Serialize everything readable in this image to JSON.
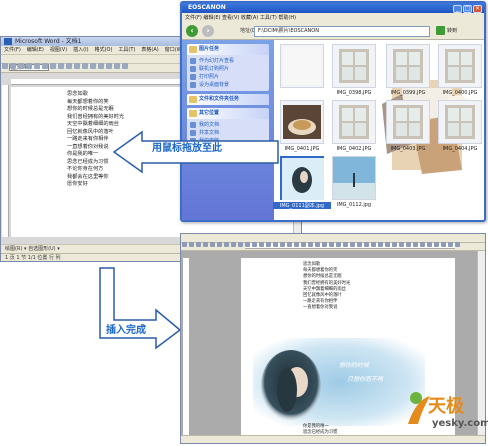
{
  "word_window": {
    "title": "Microsoft Word - 文档1",
    "menus": [
      "文件(F)",
      "编辑(E)",
      "视图(V)",
      "插入(I)",
      "格式(O)",
      "工具(T)",
      "表格(A)",
      "窗口(W)",
      "帮助(H)"
    ],
    "style_box": "正文 宋体",
    "doc_lines": [
      "思念如歌",
      "每天都想着你的笑",
      "想你的时候总是无眠",
      "我们曾经拥有的美好时光",
      "天空中飘着细细的雨丝",
      "回忆就像风中的落叶",
      "一路走来有你相伴",
      "一直想着你对我说",
      "你是我的唯一",
      "思念已经成为习惯",
      "不论你身在何方",
      "我都会在这里等你",
      "愿你安好"
    ],
    "drawbar_label": "绘图(R) ▾  自选图形(U) ▾",
    "status_text": "1 页  1 节  1/1  位置  行  列"
  },
  "explorer_window": {
    "title": "EOSCANON",
    "menus": "文件(F)  编辑(E)  查看(V)  收藏(A)  工具(T)  帮助(H)",
    "address_label": "地址(D)",
    "address_path": "F:\\DCIM\\照片\\EOSCANON",
    "go_label": "转到",
    "sidebar": {
      "picture_tasks": {
        "title": "图片任务",
        "items": [
          "作为幻灯片查看",
          "联机订购照片",
          "打印照片",
          "设为桌面背景"
        ]
      },
      "file_tasks": {
        "title": "文件和文件夹任务"
      },
      "other_places": {
        "title": "其它位置",
        "items": [
          "我的文档",
          "共享文档",
          "我的电脑",
          "网上邻居"
        ]
      }
    },
    "thumbnails": [
      {
        "name": "",
        "kind": "blank"
      },
      {
        "name": "IMG_0398.JPG",
        "kind": "window"
      },
      {
        "name": "IMG_0399.JPG",
        "kind": "window"
      },
      {
        "name": "IMG_0400.JPG",
        "kind": "window"
      },
      {
        "name": "IMG_0401.JPG",
        "kind": "food"
      },
      {
        "name": "IMG_0402.JPG",
        "kind": "window"
      },
      {
        "name": "IMG_0403.JPG",
        "kind": "window"
      },
      {
        "name": "IMG_0404.JPG",
        "kind": "window"
      },
      {
        "name": "IMG_0111副本.jpg",
        "kind": "girl",
        "selected": true
      },
      {
        "name": "IMG_0112.jpg",
        "kind": "sky"
      }
    ]
  },
  "word_window_2": {
    "lines": [
      "思念如歌",
      "每天都想着你的笑",
      "想你的时候总是无眠",
      "我们曾经拥有的美好时光",
      "天空中飘着细细的雨丝",
      "回忆就像风中的落叶",
      "一路走来有你相伴",
      "一直想着你对我说"
    ],
    "picture_text_1": "想你的时候",
    "picture_text_2": "只想你而不再",
    "lines_bottom": [
      "你是我的唯一",
      "思念已经成为习惯"
    ]
  },
  "callouts": {
    "drag_label": "用鼠标拖放至此",
    "done_label": "插入完成"
  },
  "watermark": {
    "brand": "天极",
    "site": "yesky.com"
  },
  "colors": {
    "arrow_fill": "#ffffff",
    "arrow_stroke": "#2a5ca8",
    "label_blue": "#1a66c9",
    "brand_orange": "#e58b1c",
    "brand_green": "#6cb33f"
  }
}
